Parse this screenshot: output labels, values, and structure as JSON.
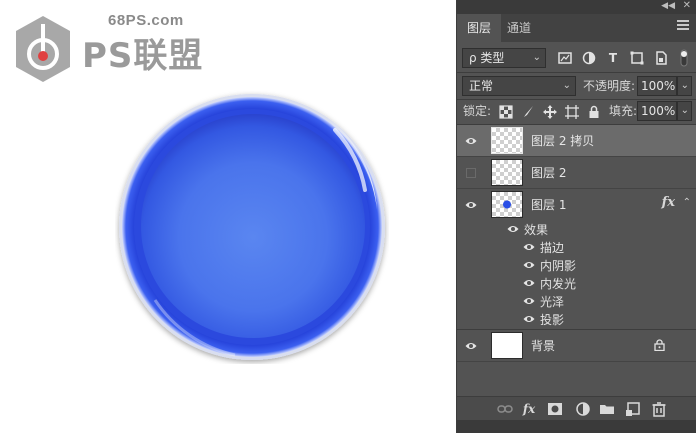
{
  "canvas": {
    "watermark": {
      "url": "68PS.com",
      "brand": "PS联盟"
    }
  },
  "panel": {
    "tabs": [
      {
        "label": "图层",
        "active": true
      },
      {
        "label": "通道",
        "active": false
      }
    ],
    "filter": {
      "kind_label": "ρ 类型"
    },
    "blend_mode": "正常",
    "opacity_label": "不透明度:",
    "opacity_value": "100%",
    "lock_label": "锁定:",
    "fill_label": "填充:",
    "fill_value": "100%",
    "layers": [
      {
        "name": "图层 2 拷贝",
        "visible": true,
        "selected": true
      },
      {
        "name": "图层 2",
        "visible": false,
        "selected": false
      },
      {
        "name": "图层 1",
        "visible": true,
        "selected": false,
        "fx": "fx"
      },
      {
        "name": "背景",
        "visible": true,
        "selected": false,
        "locked": true
      }
    ],
    "effects_label": "效果",
    "effects": [
      "描边",
      "内阴影",
      "内发光",
      "光泽",
      "投影"
    ]
  },
  "colors": {
    "sphere_blue": "#2a4fe6",
    "panel_bg": "#535353",
    "selected_row": "#6b6b6b"
  }
}
